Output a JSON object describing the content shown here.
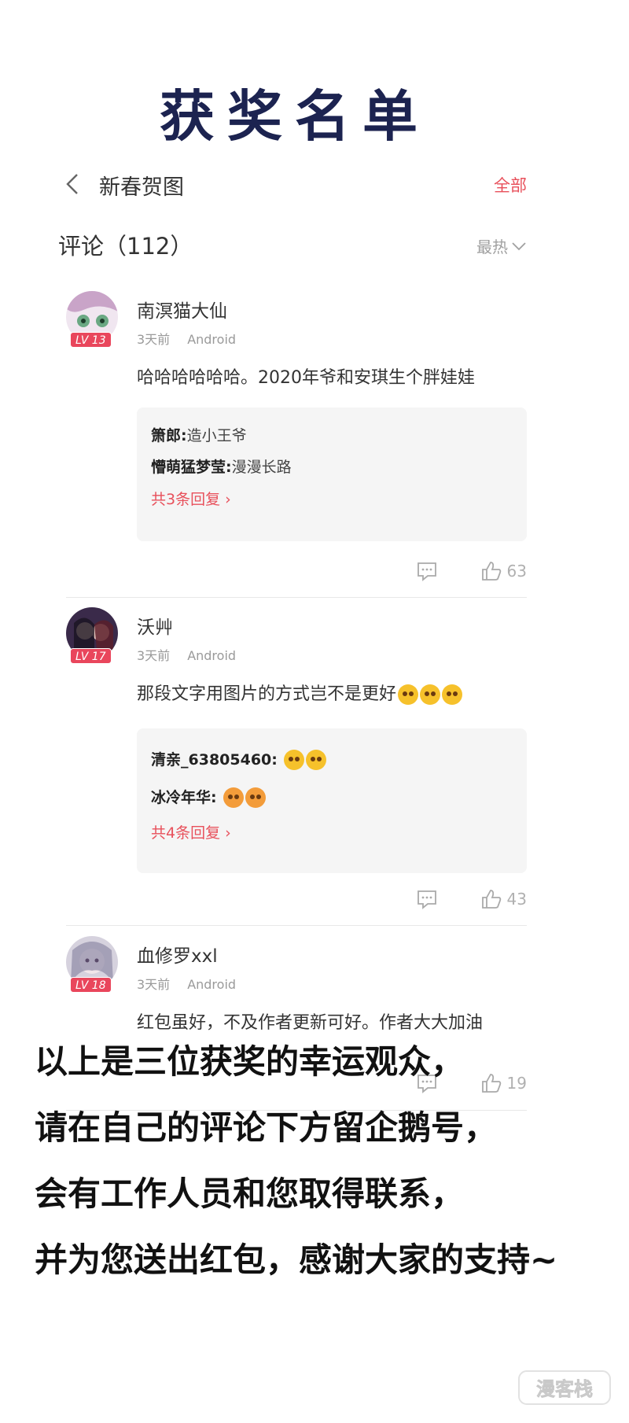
{
  "banner": {
    "title": "获奖名单"
  },
  "nav": {
    "title": "新春贺图",
    "all_label": "全部"
  },
  "comments_header": {
    "title": "评论（112）",
    "sort_label": "最热"
  },
  "comments": [
    {
      "username": "南溟猫大仙",
      "level": "LV 13",
      "time": "3天前",
      "device": "Android",
      "content": "哈哈哈哈哈哈。2020年爷和安琪生个胖娃娃",
      "replies": [
        {
          "user": "箫郎:",
          "text": " 造小王爷"
        },
        {
          "user": "懵萌猛梦莹:",
          "text": " 漫漫长路"
        }
      ],
      "more_replies": "共3条回复",
      "likes": "63"
    },
    {
      "username": "沃艸",
      "level": "LV 17",
      "time": "3天前",
      "device": "Android",
      "content": "那段文字用图片的方式岂不是更好",
      "replies": [
        {
          "user": "清亲_63805460:",
          "text": " "
        },
        {
          "user": "冰冷年华:",
          "text": " "
        }
      ],
      "more_replies": "共4条回复",
      "likes": "43"
    },
    {
      "username": "血修罗xxl",
      "level": "LV 18",
      "time": "3天前",
      "device": "Android",
      "content": "红包虽好，不及作者更新可好。作者大大加油",
      "replies": [],
      "more_replies": "",
      "likes": "19"
    }
  ],
  "footer": {
    "lines": [
      "以上是三位获奖的幸运观众，",
      "请在自己的评论下方留企鹅号，",
      "会有工作人员和您取得联系，",
      "并为您送出红包，感谢大家的支持~"
    ]
  },
  "watermark": {
    "text": "漫客栈"
  },
  "colors": {
    "accent": "#e8505b",
    "title_navy": "#1c2350",
    "badge": "#e9465c"
  }
}
